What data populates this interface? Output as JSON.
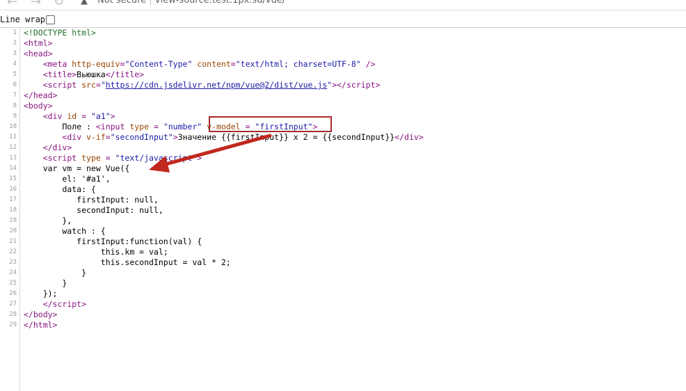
{
  "browser": {
    "security_text": "Not secure",
    "separator": "|",
    "url": "view-source:test.1px.su/vue/"
  },
  "toolbar": {
    "line_wrap_label": "Line wrap",
    "line_wrap_checked": false
  },
  "code_lines": [
    {
      "n": "1",
      "html": "<span class=\"c\">&lt;!DOCTYPE html&gt;</span>"
    },
    {
      "n": "2",
      "html": "<span class=\"t\">&lt;html&gt;</span>"
    },
    {
      "n": "3",
      "html": "<span class=\"t\">&lt;head&gt;</span>"
    },
    {
      "n": "4",
      "html": "    <span class=\"t\">&lt;meta </span><span class=\"a\">http-equiv</span><span class=\"t\">=</span><span class=\"v\">\"Content-Type\"</span><span class=\"t\"> </span><span class=\"a\">content</span><span class=\"t\">=</span><span class=\"v\">\"text/html; charset=UTF-8\"</span><span class=\"t\"> /&gt;</span>"
    },
    {
      "n": "5",
      "html": "    <span class=\"t\">&lt;title&gt;</span>Вьюшка<span class=\"t\">&lt;/title&gt;</span>"
    },
    {
      "n": "6",
      "html": "    <span class=\"t\">&lt;script </span><span class=\"a\">src</span><span class=\"t\">=</span><span class=\"v\">\"</span><span class=\"lnk\">https://cdn.jsdelivr.net/npm/vue@2/dist/vue.js</span><span class=\"v\">\"</span><span class=\"t\">&gt;&lt;/script&gt;</span>"
    },
    {
      "n": "7",
      "html": "<span class=\"t\">&lt;/head&gt;</span>"
    },
    {
      "n": "8",
      "html": "<span class=\"t\">&lt;body&gt;</span>"
    },
    {
      "n": "9",
      "html": "    <span class=\"t\">&lt;div </span><span class=\"a\">id </span><span class=\"t\">= </span><span class=\"v\">\"a1\"</span><span class=\"t\">&gt;</span>"
    },
    {
      "n": "10",
      "html": "        Поле : <span class=\"t\">&lt;input </span><span class=\"a\">type </span><span class=\"t\">= </span><span class=\"v\">\"number\"</span><span class=\"t\"> </span><span class=\"a\">v-model </span><span class=\"t\">= </span><span class=\"v\">\"firstInput\"</span><span class=\"t\">&gt;</span>"
    },
    {
      "n": "11",
      "html": "        <span class=\"t\">&lt;div </span><span class=\"a\">v-if</span><span class=\"t\">=</span><span class=\"v\">\"secondInput\"</span><span class=\"t\">&gt;</span>Значение {{firstInput}} x 2 = {{secondInput}}<span class=\"t\">&lt;/div&gt;</span>"
    },
    {
      "n": "12",
      "html": "    <span class=\"t\">&lt;/div&gt;</span>"
    },
    {
      "n": "13",
      "html": "    <span class=\"t\">&lt;script </span><span class=\"a\">type </span><span class=\"t\">= </span><span class=\"v\">\"text/javascript\"</span><span class=\"t\">&gt;</span>"
    },
    {
      "n": "14",
      "html": "    var vm = new Vue({"
    },
    {
      "n": "15",
      "html": "        el: '#a1',"
    },
    {
      "n": "16",
      "html": "        data: {"
    },
    {
      "n": "17",
      "html": "           firstInput: null,"
    },
    {
      "n": "18",
      "html": "           secondInput: null,"
    },
    {
      "n": "19",
      "html": "        },"
    },
    {
      "n": "20",
      "html": "        watch : {"
    },
    {
      "n": "21",
      "html": "           firstInput:function(val) {"
    },
    {
      "n": "22",
      "html": "                this.km = val;"
    },
    {
      "n": "23",
      "html": "                this.secondInput = val * 2;"
    },
    {
      "n": "24",
      "html": "            }"
    },
    {
      "n": "25",
      "html": "        }"
    },
    {
      "n": "26",
      "html": "    });"
    },
    {
      "n": "27",
      "html": "    <span class=\"t\">&lt;/script&gt;</span>"
    },
    {
      "n": "28",
      "html": "<span class=\"t\">&lt;/body&gt;</span>"
    },
    {
      "n": "29",
      "html": "<span class=\"t\">&lt;/html&gt;</span>"
    }
  ],
  "annotation": {
    "highlight_color": "#a52a2a",
    "arrow_color": "#c0281e"
  }
}
